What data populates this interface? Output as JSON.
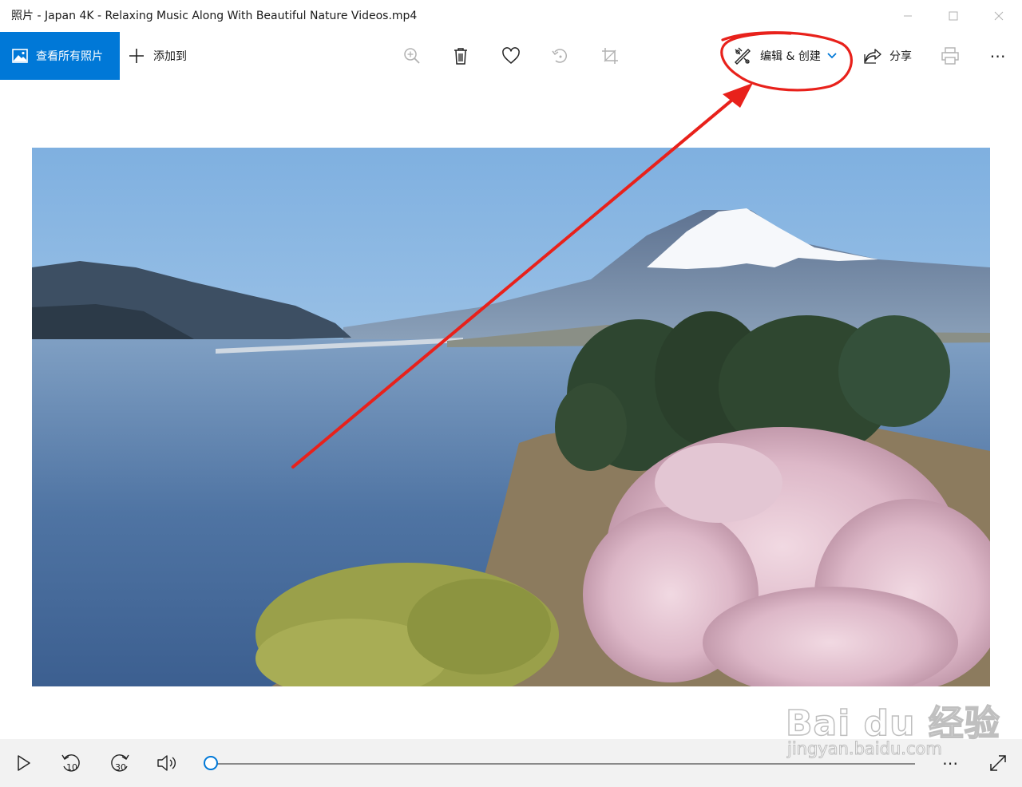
{
  "window": {
    "title": "照片 - Japan 4K - Relaxing Music Along With Beautiful Nature Videos.mp4",
    "controls": [
      "minimize",
      "maximize",
      "close"
    ]
  },
  "toolbar": {
    "view_all_label": "查看所有照片",
    "add_to_label": "添加到",
    "edit_create_label": "编辑 & 创建",
    "share_label": "分享",
    "tools": [
      "zoom-in-icon",
      "delete-icon",
      "heart-icon",
      "rotate-icon",
      "crop-icon"
    ],
    "more_label": "⋯"
  },
  "media": {
    "scene": [
      "sky",
      "snow-capped-mountain",
      "hills",
      "lake",
      "bridge",
      "trees",
      "cherry-blossoms",
      "willow"
    ]
  },
  "player": {
    "skip_back_label": "10",
    "skip_forward_label": "30",
    "progress": 0.0,
    "more_label": "⋯"
  },
  "watermark": {
    "brand": "Bai du 经验",
    "site": "jingyan.baidu.com"
  },
  "colors": {
    "accent": "#0078d7",
    "annotation": "#e8211b"
  }
}
